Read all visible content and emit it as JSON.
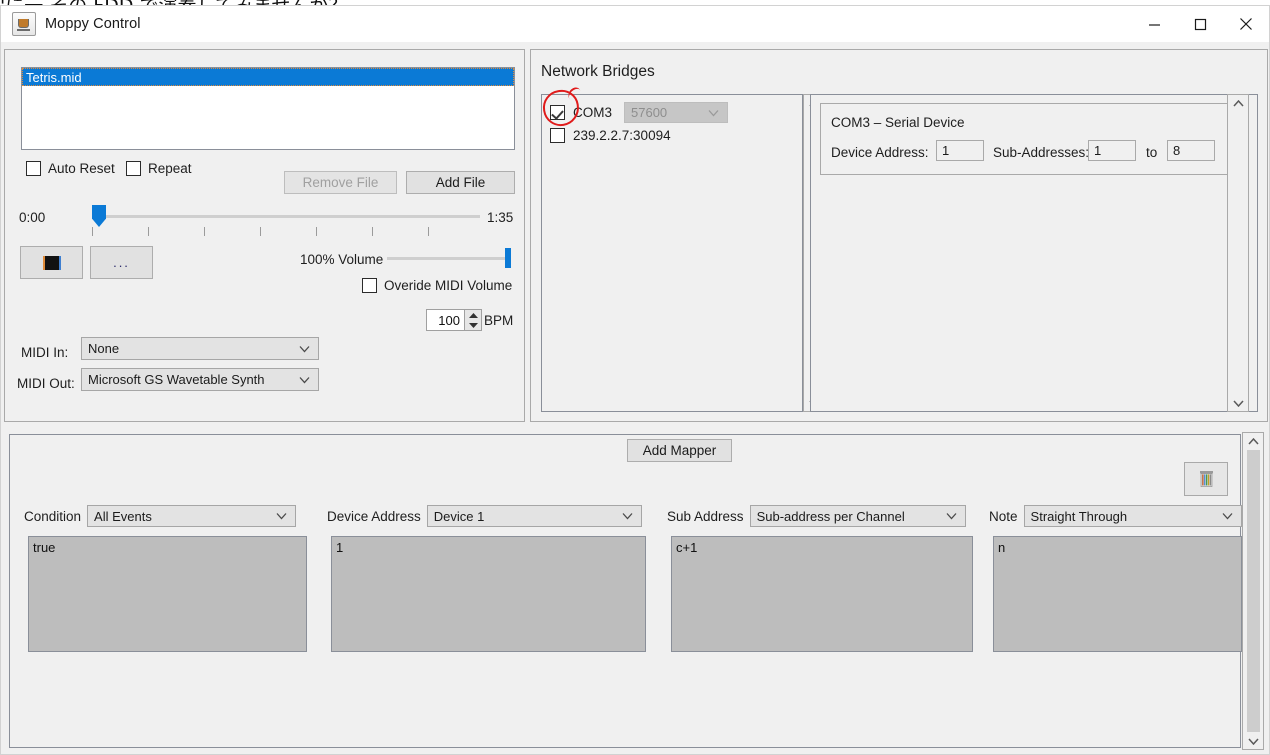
{
  "background": {
    "text": "'に一 その FDD で演奏してみませんか？"
  },
  "window": {
    "title": "Moppy Control",
    "icon": "java-coffee-cup-icon",
    "controls": {
      "minimize": "—",
      "maximize": "□",
      "close": "✕"
    }
  },
  "player": {
    "file_list": [
      {
        "name": "Tetris.mid",
        "selected": true
      }
    ],
    "auto_reset": {
      "label": "Auto Reset",
      "checked": false
    },
    "repeat": {
      "label": "Repeat",
      "checked": false
    },
    "remove_file_label": "Remove File",
    "remove_file_enabled": false,
    "add_file_label": "Add File",
    "time_current": "0:00",
    "time_total": "1:35",
    "position_percent": 2,
    "stop_label": "stop-square",
    "more_label": "...",
    "volume_label": "100% Volume",
    "volume_percent": 100,
    "override_midi_volume": {
      "label": "Overide MIDI Volume",
      "checked": false
    },
    "bpm_value": "100",
    "bpm_label": "BPM",
    "midi_in_label": "MIDI In:",
    "midi_in_value": "None",
    "midi_out_label": "MIDI Out:",
    "midi_out_value": "Microsoft GS Wavetable Synth"
  },
  "network": {
    "title": "Network Bridges",
    "bridges": [
      {
        "name": "COM3",
        "checked": true,
        "baud": "57600",
        "baud_enabled": false,
        "annotated": true
      },
      {
        "name": "239.2.2.7:30094",
        "checked": false
      }
    ],
    "device": {
      "title": "COM3 – Serial Device",
      "device_address_label": "Device Address:",
      "device_address_value": "1",
      "sub_addresses_label": "Sub-Addresses:",
      "sub_from": "1",
      "to_label": "to",
      "sub_to": "8"
    }
  },
  "mapper": {
    "add_mapper_label": "Add Mapper",
    "delete_icon": "trash-icon",
    "columns": [
      {
        "label": "Condition",
        "select_value": "All Events",
        "text_value": "true"
      },
      {
        "label": "Device Address",
        "select_value": "Device 1",
        "text_value": "1"
      },
      {
        "label": "Sub Address",
        "select_value": "Sub-address per Channel",
        "text_value": "c+1"
      },
      {
        "label": "Note",
        "select_value": "Straight Through",
        "text_value": "n"
      }
    ]
  },
  "colors": {
    "accent_blue": "#0b7ad6",
    "annotation_red": "#e01b1b",
    "panel_bg": "#f0f0f0",
    "textarea_bg": "#bdbdbd"
  }
}
